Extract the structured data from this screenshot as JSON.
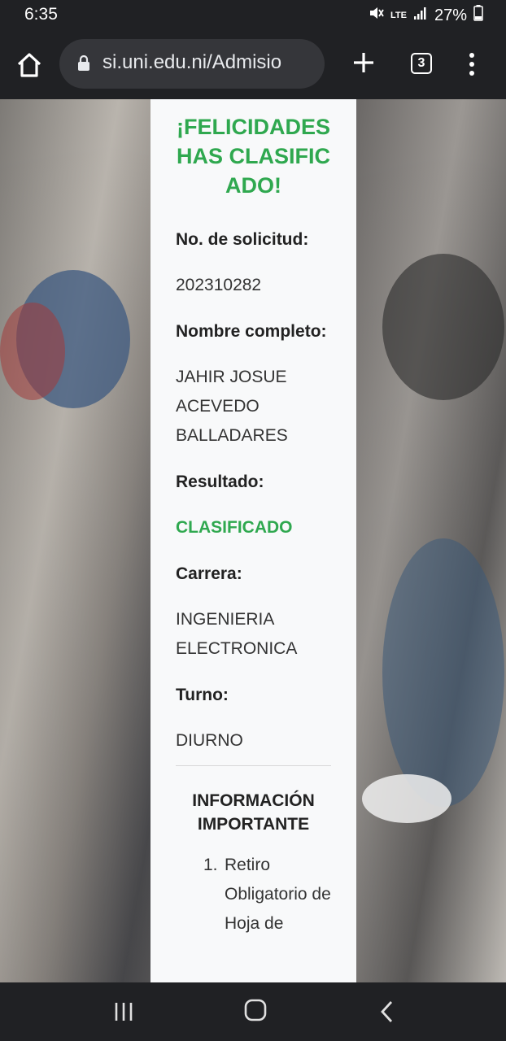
{
  "status_bar": {
    "time": "6:35",
    "network": "LTE",
    "battery": "27%"
  },
  "browser": {
    "url": "si.uni.edu.ni/Admisio",
    "tab_count": "3"
  },
  "result_card": {
    "title": "¡FELICIDADES HAS CLASIFICADO!",
    "fields": [
      {
        "label": "No. de solicitud:",
        "value": "202310282"
      },
      {
        "label": "Nombre completo:",
        "value": "JAHIR JOSUE ACEVEDO BALLADARES"
      },
      {
        "label": "Resultado:",
        "value": "CLASIFICADO"
      },
      {
        "label": "Carrera:",
        "value": "INGENIERIA ELECTRONICA"
      },
      {
        "label": "Turno:",
        "value": "DIURNO"
      }
    ],
    "info_title": "INFORMACIÓN IMPORTANTE",
    "info_items": [
      {
        "number": "1.",
        "text": "Retiro Obligatorio de Hoja de"
      }
    ]
  },
  "colors": {
    "accent_green": "#2fa84f",
    "browser_chrome": "#202124"
  }
}
